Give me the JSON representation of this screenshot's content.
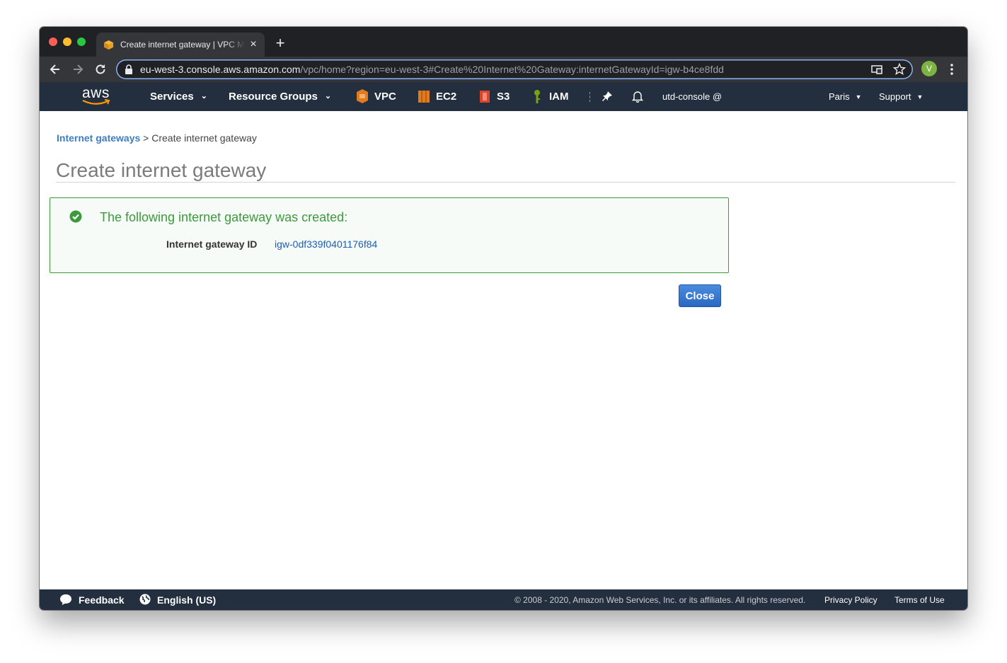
{
  "browser": {
    "tab_title": "Create internet gateway | VPC Management Console",
    "new_tab_label": "+",
    "close_tab_label": "×",
    "url_host": "eu-west-3.console.aws.amazon.com",
    "url_path": "/vpc/home?region=eu-west-3#Create%20Internet%20Gateway:internetGatewayId=igw-b4ce8fdd",
    "profile_initial": "V"
  },
  "aws_nav": {
    "logo_text": "aws",
    "services_label": "Services",
    "resource_groups_label": "Resource Groups",
    "shortcuts": [
      {
        "label": "VPC",
        "icon": "vpc-icon",
        "color": "#e07b1f"
      },
      {
        "label": "EC2",
        "icon": "ec2-icon",
        "color": "#e07b1f"
      },
      {
        "label": "S3",
        "icon": "s3-icon",
        "color": "#d9442b"
      },
      {
        "label": "IAM",
        "icon": "iam-icon",
        "color": "#7aa116"
      }
    ],
    "account_label": "utd-console @",
    "region_label": "Paris",
    "support_label": "Support"
  },
  "main": {
    "breadcrumb_link": "Internet gateways",
    "breadcrumb_separator": " > ",
    "breadcrumb_current": "Create internet gateway",
    "page_title": "Create internet gateway",
    "success_message": "The following internet gateway was created:",
    "field_label": "Internet gateway ID",
    "field_value": "igw-0df339f0401176f84",
    "close_button_label": "Close"
  },
  "footer": {
    "feedback_label": "Feedback",
    "language_label": "English (US)",
    "copyright": "© 2008 - 2020, Amazon Web Services, Inc. or its affiliates. All rights reserved.",
    "privacy_label": "Privacy Policy",
    "terms_label": "Terms of Use"
  },
  "colors": {
    "aws_nav_bg": "#232f3e",
    "success_green": "#3c9a3c",
    "link_blue": "#3f7fbf",
    "primary_button": "#2a68c2"
  }
}
